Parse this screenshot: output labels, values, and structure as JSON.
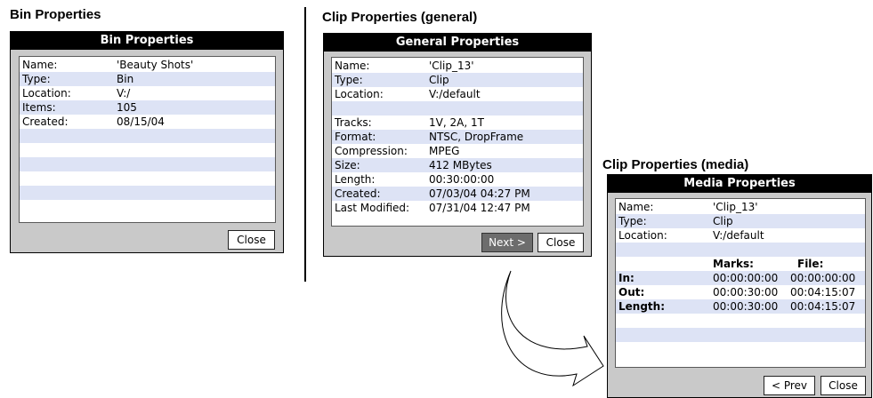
{
  "captions": {
    "bin": "Bin Properties",
    "clip_general": "Clip Properties (general)",
    "clip_media": "Clip Properties (media)"
  },
  "bin_dialog": {
    "title": "Bin Properties",
    "rows": [
      {
        "label": "Name:",
        "value": "'Beauty Shots'"
      },
      {
        "label": "Type:",
        "value": "Bin"
      },
      {
        "label": "Location:",
        "value": "V:/"
      },
      {
        "label": "Items:",
        "value": "105"
      },
      {
        "label": "Created:",
        "value": "08/15/04"
      }
    ],
    "close_label": "Close"
  },
  "general_dialog": {
    "title": "General Properties",
    "rows": [
      {
        "label": "Name:",
        "value": "'Clip_13'"
      },
      {
        "label": "Type:",
        "value": "Clip"
      },
      {
        "label": "Location:",
        "value": "V:/default"
      },
      {
        "label": "",
        "value": ""
      },
      {
        "label": "Tracks:",
        "value": "1V, 2A, 1T"
      },
      {
        "label": "Format:",
        "value": "NTSC, DropFrame"
      },
      {
        "label": "Compression:",
        "value": "MPEG"
      },
      {
        "label": "Size:",
        "value": "412 MBytes"
      },
      {
        "label": "Length:",
        "value": "00:30:00:00"
      },
      {
        "label": "Created:",
        "value": "07/03/04 04:27 PM"
      },
      {
        "label": "Last Modified:",
        "value": "07/31/04 12:47 PM"
      }
    ],
    "next_label": "Next >",
    "close_label": "Close"
  },
  "media_dialog": {
    "title": "Media Properties",
    "rows": [
      {
        "label": "Name:",
        "value": "'Clip_13'"
      },
      {
        "label": "Type:",
        "value": "Clip"
      },
      {
        "label": "Location:",
        "value": "V:/default"
      }
    ],
    "columns": {
      "marks": "Marks:",
      "file": "File:"
    },
    "timecodes": [
      {
        "label": "In:",
        "marks": "00:00:00:00",
        "file": "00:00:00:00"
      },
      {
        "label": "Out:",
        "marks": "00:00:30:00",
        "file": "00:04:15:07"
      },
      {
        "label": "Length:",
        "marks": "00:00:30:00",
        "file": "00:04:15:07"
      }
    ],
    "prev_label": "< Prev",
    "close_label": "Close"
  },
  "colors": {
    "row_shade": "#dde3f5",
    "dialog_bg": "#c9c9c9",
    "title_bar": "#000000"
  }
}
